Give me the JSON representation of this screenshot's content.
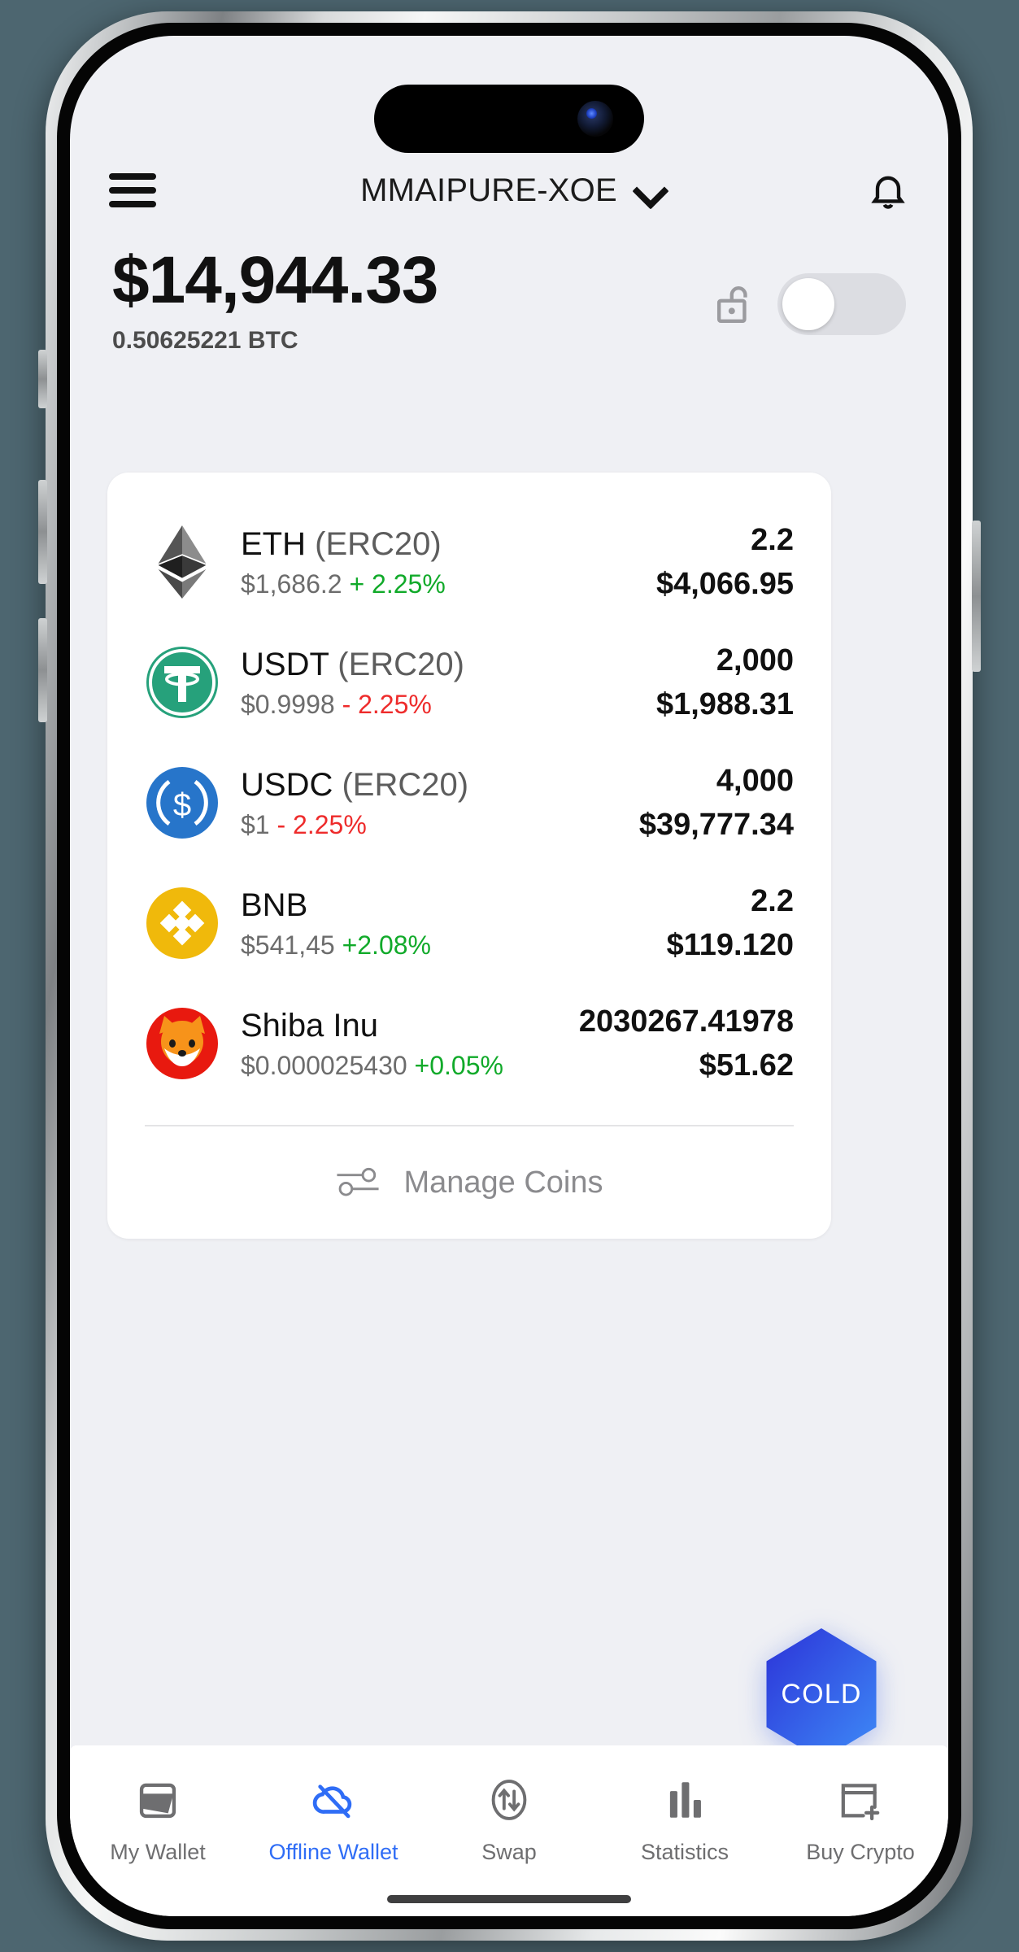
{
  "theme": {
    "page_background": "#4d6670",
    "screen_background": "#eff0f4",
    "card_background": "#ffffff",
    "accent": "#2f6df6",
    "positive": "#11aa2a",
    "negative": "#ee2b2b",
    "muted_text": "#6c6c6c"
  },
  "header": {
    "menu_icon": "hamburger-menu-icon",
    "wallet_title": "MMAIPURE-XOE",
    "chevron_icon": "chevron-down-icon",
    "notification_icon": "bell-icon"
  },
  "balance": {
    "fiat_total": "$14,944.33",
    "crypto_total": "0.50625221 BTC",
    "lock_icon": "unlock-padlock-icon",
    "toggle": {
      "name": "privacy-toggle",
      "state": "off"
    }
  },
  "coins": [
    {
      "symbol": "ETH",
      "network": "(ERC20)",
      "icon": "ethereum-icon",
      "price": "$1,686.2",
      "change": "+ 2.25%",
      "direction": "up",
      "amount": "2.2",
      "value": "$4,066.95"
    },
    {
      "symbol": "USDT",
      "network": "(ERC20)",
      "icon": "tether-icon",
      "price": "$0.9998",
      "change": "- 2.25%",
      "direction": "down",
      "amount": "2,000",
      "value": "$1,988.31"
    },
    {
      "symbol": "USDC",
      "network": "(ERC20)",
      "icon": "usd-coin-icon",
      "price": "$1",
      "change": "- 2.25%",
      "direction": "down",
      "amount": "4,000",
      "value": "$39,777.34"
    },
    {
      "symbol": "BNB",
      "network": "",
      "icon": "binance-coin-icon",
      "price": "$541,45",
      "change": "+2.08%",
      "direction": "up",
      "amount": "2.2",
      "value": "$119.120"
    },
    {
      "symbol": "Shiba Inu",
      "network": "",
      "icon": "shiba-inu-icon",
      "price": "$0.000025430",
      "change": "+0.05%",
      "direction": "up",
      "amount": "2030267.41978",
      "value": "$51.62"
    }
  ],
  "manage": {
    "icon": "sliders-icon",
    "label": "Manage Coins"
  },
  "cold_badge": {
    "label": "COLD",
    "shape": "hexagon",
    "gradient_start": "#2c33d8",
    "gradient_end": "#3e8bf7"
  },
  "bottom_nav": {
    "items": [
      {
        "label": "My Wallet",
        "icon": "wallet-icon",
        "active": false
      },
      {
        "label": "Offline Wallet",
        "icon": "cloud-offline-icon",
        "active": true
      },
      {
        "label": "Swap",
        "icon": "swap-arrows-icon",
        "active": false
      },
      {
        "label": "Statistics",
        "icon": "bar-chart-icon",
        "active": false
      },
      {
        "label": "Buy Crypto",
        "icon": "card-plus-icon",
        "active": false
      }
    ]
  }
}
